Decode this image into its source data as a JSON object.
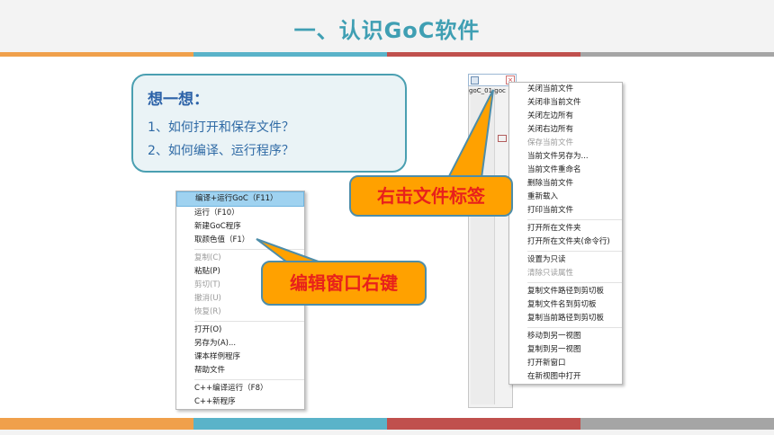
{
  "slide": {
    "title": "一、认识GoC软件"
  },
  "colors": {
    "stripe": [
      "#f0a04b",
      "#5ab3c9",
      "#c0504d",
      "#a5a5a5"
    ],
    "callout_bg": "#ffa100",
    "callout_text": "#e8211b"
  },
  "think_box": {
    "title": "想一想：",
    "lines": [
      "1、如何打开和保存文件？",
      "2、如何编译、运行程序？"
    ]
  },
  "editor_menu": {
    "items": [
      {
        "label": "编译+运行GoC（F11）",
        "state": "highlight"
      },
      {
        "label": "运行（F10）"
      },
      {
        "label": "新建GoC程序"
      },
      {
        "label": "取颜色值（F1）"
      },
      {
        "separator": true
      },
      {
        "label": "复制(C)",
        "state": "disabled"
      },
      {
        "label": "粘贴(P)"
      },
      {
        "label": "剪切(T)",
        "state": "disabled"
      },
      {
        "label": "撤消(U)",
        "state": "disabled"
      },
      {
        "label": "恢复(R)",
        "state": "disabled"
      },
      {
        "separator": true
      },
      {
        "label": "打开(O)"
      },
      {
        "label": "另存为(A)..."
      },
      {
        "label": "课本样例程序"
      },
      {
        "label": "帮助文件"
      },
      {
        "separator": true
      },
      {
        "label": "C++编译运行（F8）"
      },
      {
        "label": "C++新程序"
      }
    ]
  },
  "file_tab": {
    "label": "goC_01.goc"
  },
  "tab_menu": {
    "items": [
      {
        "label": "关闭当前文件"
      },
      {
        "label": "关闭非当前文件"
      },
      {
        "label": "关闭左边所有"
      },
      {
        "label": "关闭右边所有"
      },
      {
        "label": "保存当前文件",
        "state": "disabled"
      },
      {
        "label": "当前文件另存为..."
      },
      {
        "label": "当前文件重命名"
      },
      {
        "label": "删除当前文件"
      },
      {
        "label": "重新载入"
      },
      {
        "label": "打印当前文件"
      },
      {
        "separator": true
      },
      {
        "label": "打开所在文件夹"
      },
      {
        "label": "打开所在文件夹(命令行)"
      },
      {
        "separator": true
      },
      {
        "label": "设置为只读"
      },
      {
        "label": "清除只读属性",
        "state": "disabled"
      },
      {
        "separator": true
      },
      {
        "label": "复制文件路径到剪切板"
      },
      {
        "label": "复制文件名到剪切板"
      },
      {
        "label": "复制当前路径到剪切板"
      },
      {
        "separator": true
      },
      {
        "label": "移动到另一视图"
      },
      {
        "label": "复制到另一视图"
      },
      {
        "label": "打开新窗口"
      },
      {
        "label": "在新视图中打开"
      }
    ]
  },
  "callouts": {
    "tab_right_click": "右击文件标签",
    "editor_right_click": "编辑窗口右键"
  }
}
